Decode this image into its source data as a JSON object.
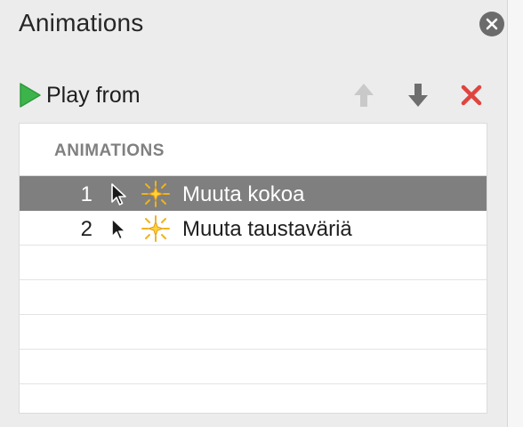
{
  "panel": {
    "title": "Animations",
    "close_icon": "close-circle-icon"
  },
  "toolbar": {
    "play_label": "Play from",
    "play_icon": "play-triangle-icon",
    "move_up_icon": "arrow-up-icon",
    "move_down_icon": "arrow-down-icon",
    "delete_icon": "red-x-icon",
    "colors": {
      "play": "#3cb44b",
      "move_up_disabled": "#c9c9c9",
      "move_down": "#6e6e6e",
      "delete": "#e0443e"
    }
  },
  "table": {
    "header": "ANIMATIONS",
    "selected_color": "#7f7f7f",
    "rows": [
      {
        "number": "1",
        "trigger_icon": "mouse-cursor-icon",
        "effect_icon": "sparkle-burst-icon",
        "name": "Muuta kokoa",
        "selected": true
      },
      {
        "number": "2",
        "trigger_icon": "mouse-cursor-icon",
        "effect_icon": "sparkle-burst-icon",
        "name": "Muuta taustaväriä",
        "selected": false
      }
    ]
  }
}
